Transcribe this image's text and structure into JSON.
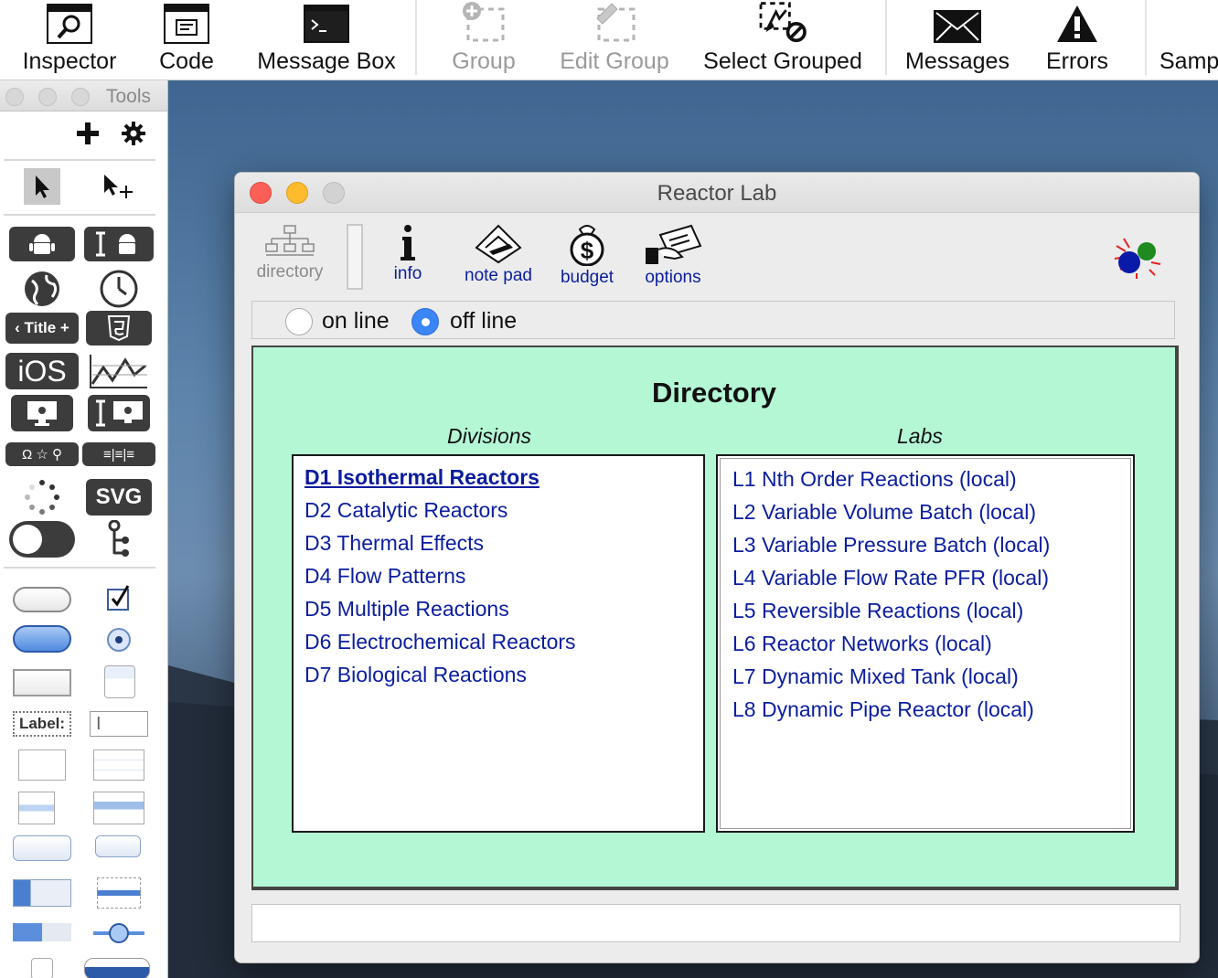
{
  "toolbar": {
    "items": [
      {
        "label": "Inspector",
        "icon": "inspector-icon",
        "enabled": true
      },
      {
        "label": "Code",
        "icon": "code-icon",
        "enabled": true
      },
      {
        "label": "Message Box",
        "icon": "message-box-icon",
        "enabled": true
      },
      {
        "label": "Group",
        "icon": "group-icon",
        "enabled": false
      },
      {
        "label": "Edit Group",
        "icon": "edit-group-icon",
        "enabled": false
      },
      {
        "label": "Select Grouped",
        "icon": "select-grouped-icon",
        "enabled": true
      },
      {
        "label": "Messages",
        "icon": "messages-icon",
        "enabled": true
      },
      {
        "label": "Errors",
        "icon": "errors-icon",
        "enabled": true
      },
      {
        "label": "Samp",
        "icon": "sample-icon",
        "enabled": true
      }
    ]
  },
  "tools_palette": {
    "title": "Tools",
    "title_widget_label": "Title",
    "ios_label": "iOS",
    "svg_label": "SVG",
    "field_label": "Label:"
  },
  "window": {
    "title": "Reactor Lab",
    "nav": {
      "directory": "directory",
      "info": "info",
      "note_pad": "note pad",
      "budget": "budget",
      "options": "options"
    },
    "mode": {
      "on_line": "on line",
      "off_line": "off line",
      "selected": "off line"
    },
    "content": {
      "heading": "Directory",
      "divisions_header": "Divisions",
      "labs_header": "Labs",
      "divisions": [
        "D1 Isothermal Reactors",
        "D2 Catalytic Reactors",
        "D3 Thermal Effects",
        "D4 Flow Patterns",
        "D5 Multiple Reactions",
        "D6 Electrochemical Reactors",
        "D7 Biological Reactions"
      ],
      "active_division": "D1 Isothermal Reactors",
      "labs": [
        "L1 Nth Order Reactions (local)",
        "L2 Variable Volume Batch (local)",
        "L3 Variable Pressure Batch (local)",
        "L4 Variable Flow Rate PFR (local)",
        "L5 Reversible Reactions (local)",
        "L6 Reactor Networks (local)",
        "L7 Dynamic Mixed Tank (local)",
        "L8 Dynamic Pipe Reactor (local)"
      ]
    },
    "status_text": ""
  },
  "colors": {
    "link_blue": "#0a1d9e",
    "panel_green": "#b4f7d5",
    "radio_selected": "#3b86f7",
    "close_red": "#fc5f57",
    "minimize_yellow": "#fdbc2e"
  }
}
